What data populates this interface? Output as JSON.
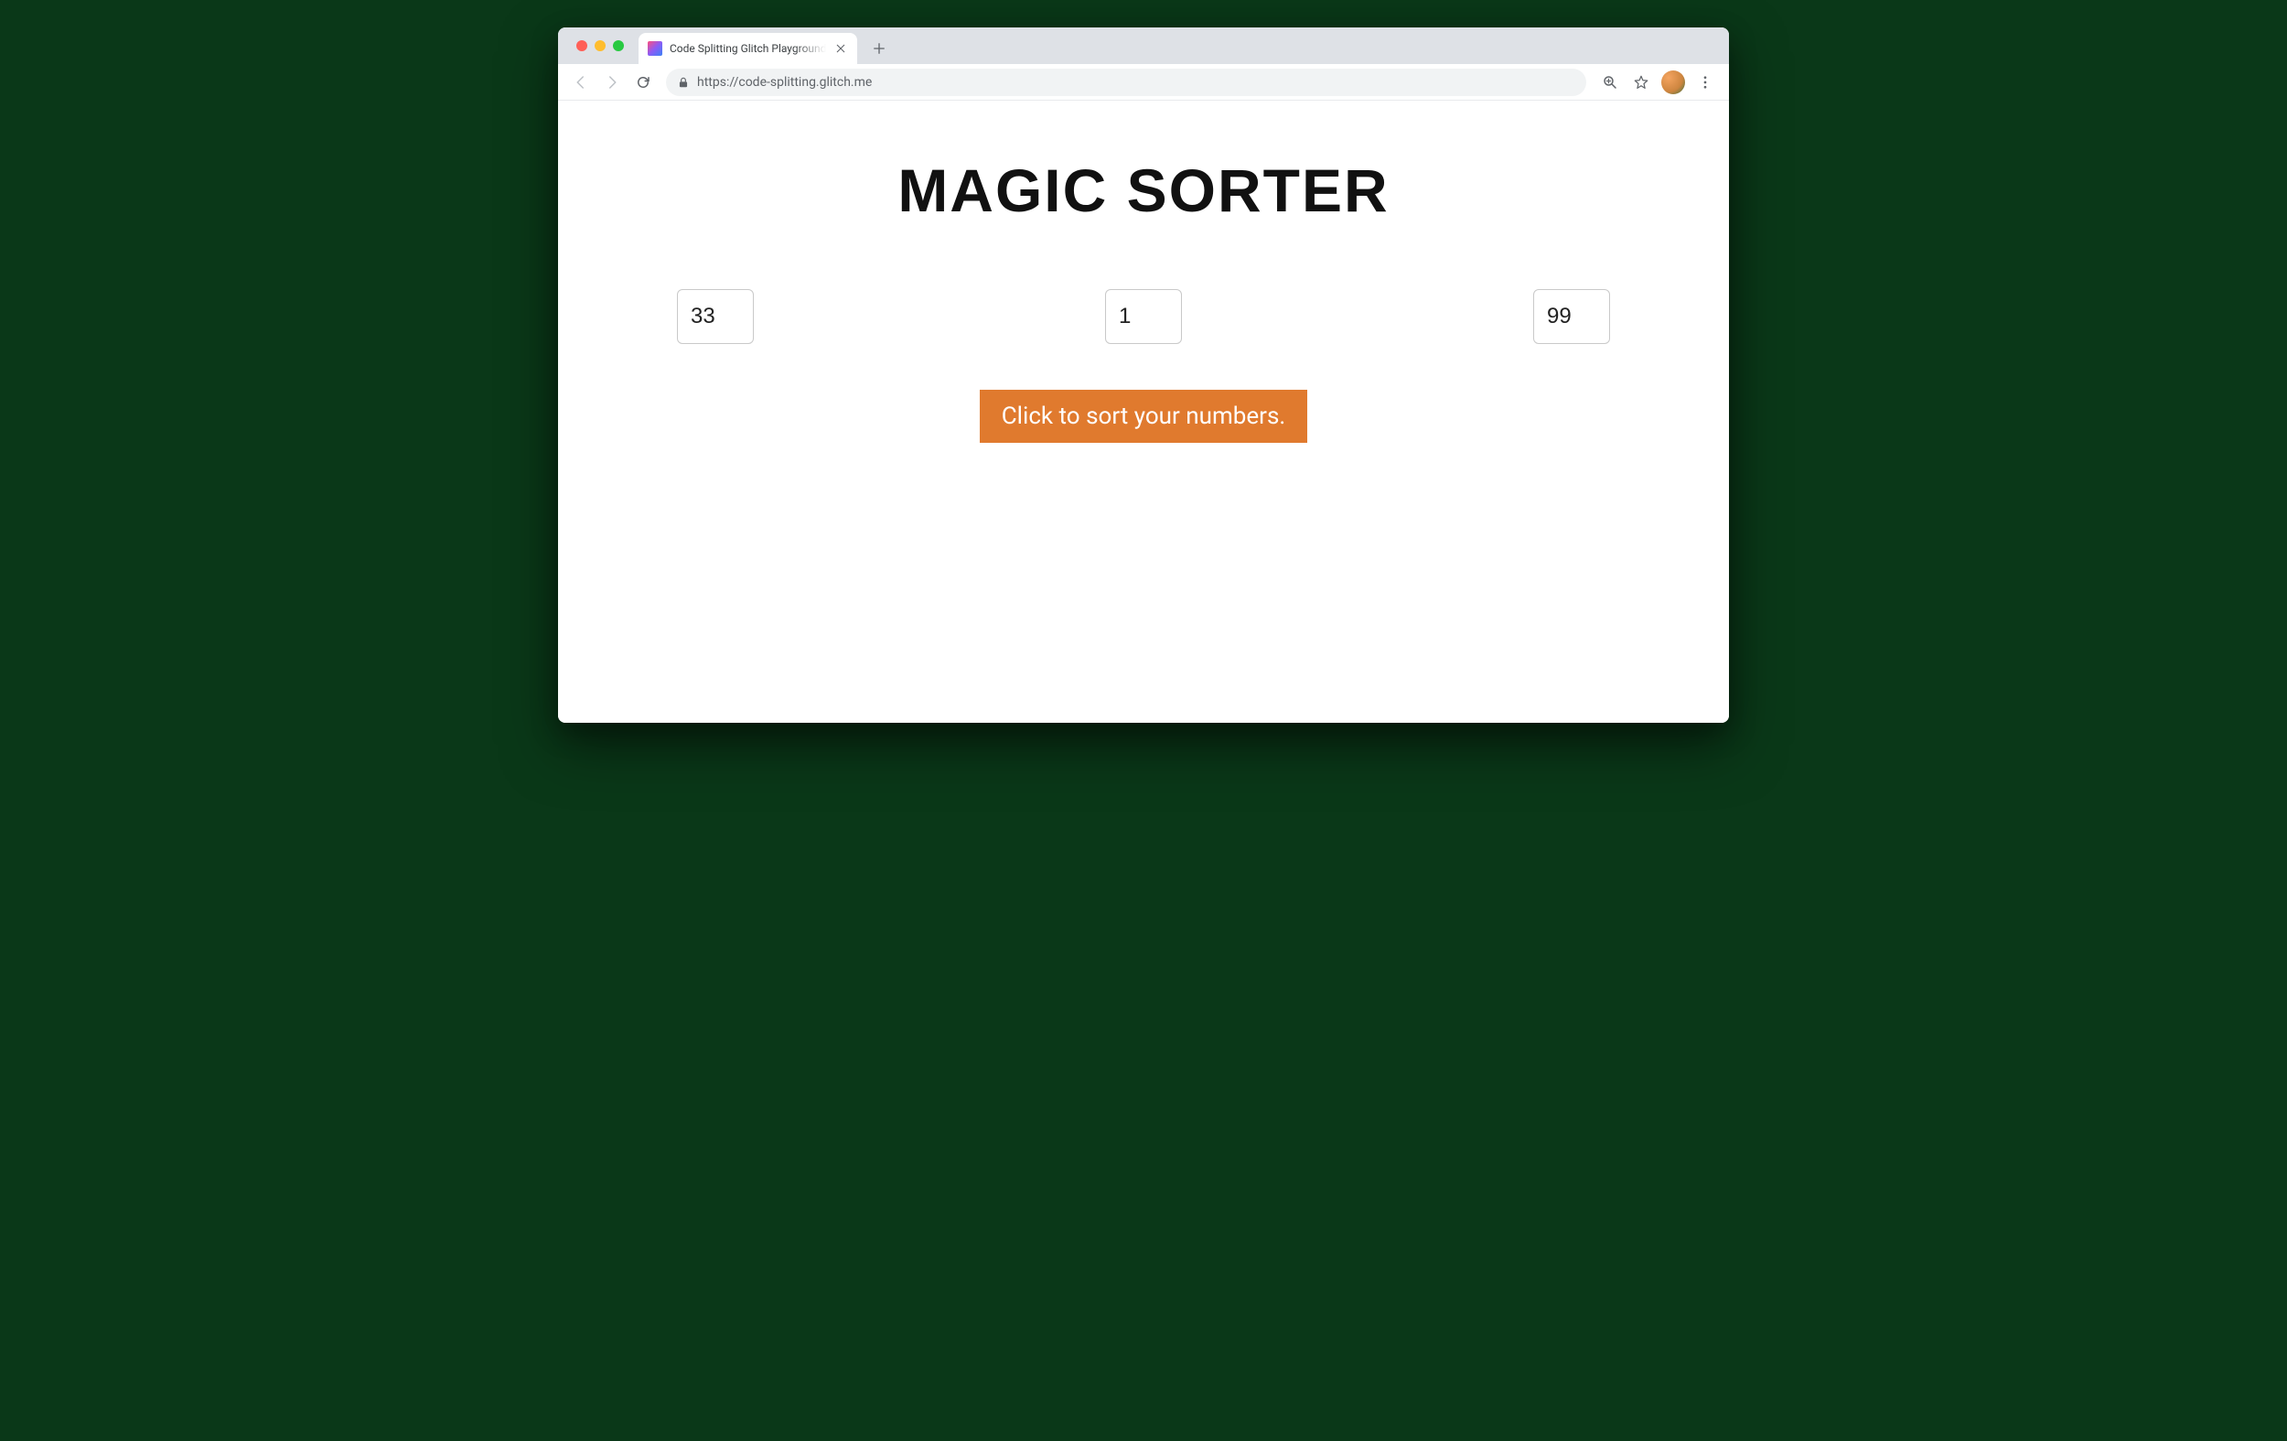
{
  "browser": {
    "tab": {
      "title": "Code Splitting Glitch Playground"
    },
    "url": "https://code-splitting.glitch.me"
  },
  "page": {
    "heading": "MAGIC SORTER",
    "inputs": {
      "value1": "33",
      "value2": "1",
      "value3": "99"
    },
    "sort_button_label": "Click to sort your numbers."
  },
  "colors": {
    "accent": "#e07a2e"
  }
}
